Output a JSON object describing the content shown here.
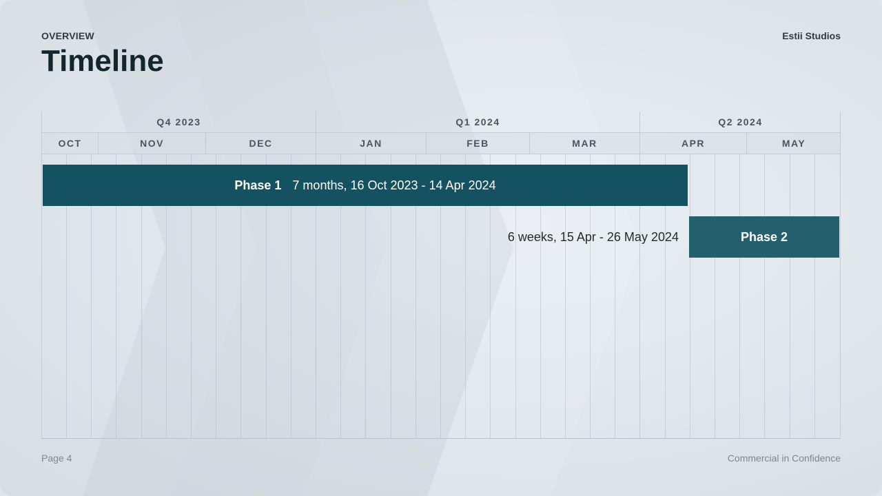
{
  "header": {
    "overview": "OVERVIEW",
    "title": "Timeline",
    "brand": "Estii Studios"
  },
  "timeline": {
    "quarters": [
      "Q4 2023",
      "Q1 2024",
      "Q2 2024"
    ],
    "months": [
      "OCT",
      "NOV",
      "DEC",
      "JAN",
      "FEB",
      "MAR",
      "APR",
      "MAY"
    ],
    "phases": [
      {
        "name": "Phase 1",
        "detail": "7 months, 16 Oct 2023 - 14 Apr 2024",
        "start": "2023-10-16",
        "end": "2024-04-14",
        "color": "#145262"
      },
      {
        "name": "Phase 2",
        "detail": "6 weeks, 15 Apr - 26 May 2024",
        "start": "2024-04-15",
        "end": "2024-05-26",
        "color": "#245f6d"
      }
    ]
  },
  "footer": {
    "page": "Page 4",
    "confidentiality": "Commercial in Confidence"
  }
}
